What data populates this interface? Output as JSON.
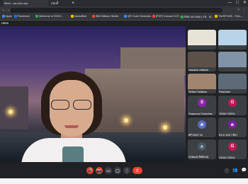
{
  "browser": {
    "tabs": [
      {
        "label": "Meet - rav-rkrv-ayz"
      },
      {
        "label": "อนันต์ี"
      }
    ],
    "new_tab": "+",
    "window_buttons": [
      "—",
      "□",
      "✕"
    ],
    "nav": "← → ↻",
    "url": "meet.google.com/rav-rkrv-ayz?authuser=1",
    "addr_icons": [
      "☆",
      "⋮"
    ]
  },
  "bookmarks": [
    {
      "label": "Apps",
      "color": "#4285f4"
    },
    {
      "label": "Facebook",
      "color": "#1877f2"
    },
    {
      "label": "Welcome to SCIM...",
      "color": "#34a853"
    },
    {
      "label": "backoffice",
      "color": "#fbbc05"
    },
    {
      "label": "IBM Watson Studio",
      "color": "#ea4335"
    },
    {
      "label": "QR Code Generato...",
      "color": "#4285f4"
    },
    {
      "label": "[PDF] Canvas CCS...",
      "color": "#ea4335"
    },
    {
      "label": "ติดตามงานผล | KB - St...",
      "color": "#34a853"
    },
    {
      "label": "TheSPOOK - FALL...",
      "color": "#fbbc05"
    }
  ],
  "meet": {
    "title": "ratas",
    "participants": [
      {
        "name": "",
        "color": "#6a9fb5"
      },
      {
        "name": "",
        "color": "#8ab4f8"
      },
      {
        "name": "nawaluk wilaisuk",
        "color": "#7a6a5a"
      },
      {
        "name": "",
        "color": "#4f6d7a"
      },
      {
        "name": "Sirilak Paitaksu",
        "color": "#9d8a7a"
      },
      {
        "name": "Patcharin",
        "color": "#5a6a7a"
      },
      {
        "name": "Suwanna Chanchar...",
        "initial": "S",
        "color": "#8e24aa"
      },
      {
        "name": "GRAD SSRU",
        "initial": "G",
        "color": "#c2185b"
      },
      {
        "name": "ศรี ธนชา ณ",
        "initial": "ศ",
        "color": "#5c6bc0"
      },
      {
        "name": "ดร.อ.วนภา ศิลา",
        "initial": "ด",
        "color": "#7b1fa2"
      },
      {
        "name": "กุลพัฒน์ สิทธิพรสุ",
        "initial": "ก",
        "color": "#455a64"
      },
      {
        "name": "GRAD SSRU",
        "initial": "G",
        "color": "#c2185b"
      }
    ],
    "controls": [
      "🎤",
      "📷",
      "CC",
      "▢",
      "⋮",
      "✆"
    ],
    "right_icons": [
      "ⓘ",
      "👥",
      "💬"
    ]
  },
  "colors": {
    "end_call": "#ea4335",
    "bg": "#202124"
  }
}
